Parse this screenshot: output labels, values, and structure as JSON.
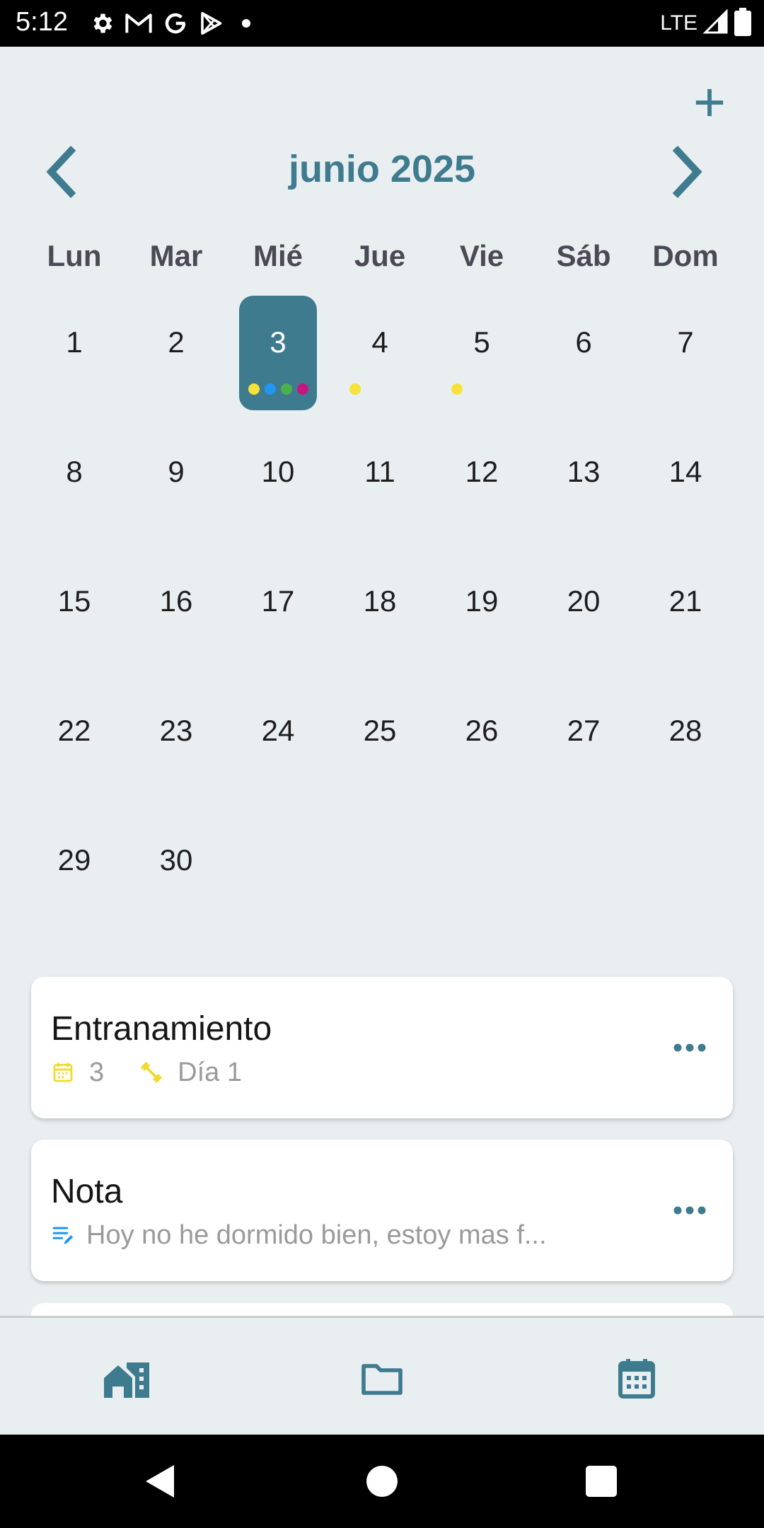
{
  "status_bar": {
    "time": "5:12",
    "network": "LTE",
    "icons": [
      "settings-icon",
      "gmail-icon",
      "google-icon",
      "play-store-icon",
      "notification-dot-icon",
      "signal-icon",
      "battery-icon"
    ]
  },
  "calendar": {
    "month_title": "junio 2025",
    "weekdays": [
      "Lun",
      "Mar",
      "Mié",
      "Jue",
      "Vie",
      "Sáb",
      "Dom"
    ],
    "days": [
      "1",
      "2",
      "3",
      "4",
      "5",
      "6",
      "7",
      "8",
      "9",
      "10",
      "11",
      "12",
      "13",
      "14",
      "15",
      "16",
      "17",
      "18",
      "19",
      "20",
      "21",
      "22",
      "23",
      "24",
      "25",
      "26",
      "27",
      "28",
      "29",
      "30"
    ],
    "selected_day": "3",
    "event_dots": {
      "3": [
        "#f7e23b",
        "#2196f3",
        "#4caf50",
        "#c2187e"
      ],
      "4": [
        "#f7e23b"
      ],
      "5": [
        "#f7e23b"
      ]
    }
  },
  "entries": [
    {
      "title": "Entranamiento",
      "count": "3",
      "day_label": "Día 1"
    },
    {
      "title": "Nota",
      "preview": "Hoy no he dormido bien, estoy mas f..."
    }
  ],
  "bottom_nav": {
    "items": [
      "home-icon",
      "folder-icon",
      "calendar-icon"
    ]
  },
  "colors": {
    "accent": "#3f7b8f",
    "background": "#e9eff1",
    "yellow": "#f7e23b",
    "blue": "#2196f3",
    "green": "#4caf50",
    "magenta": "#c2187e"
  }
}
